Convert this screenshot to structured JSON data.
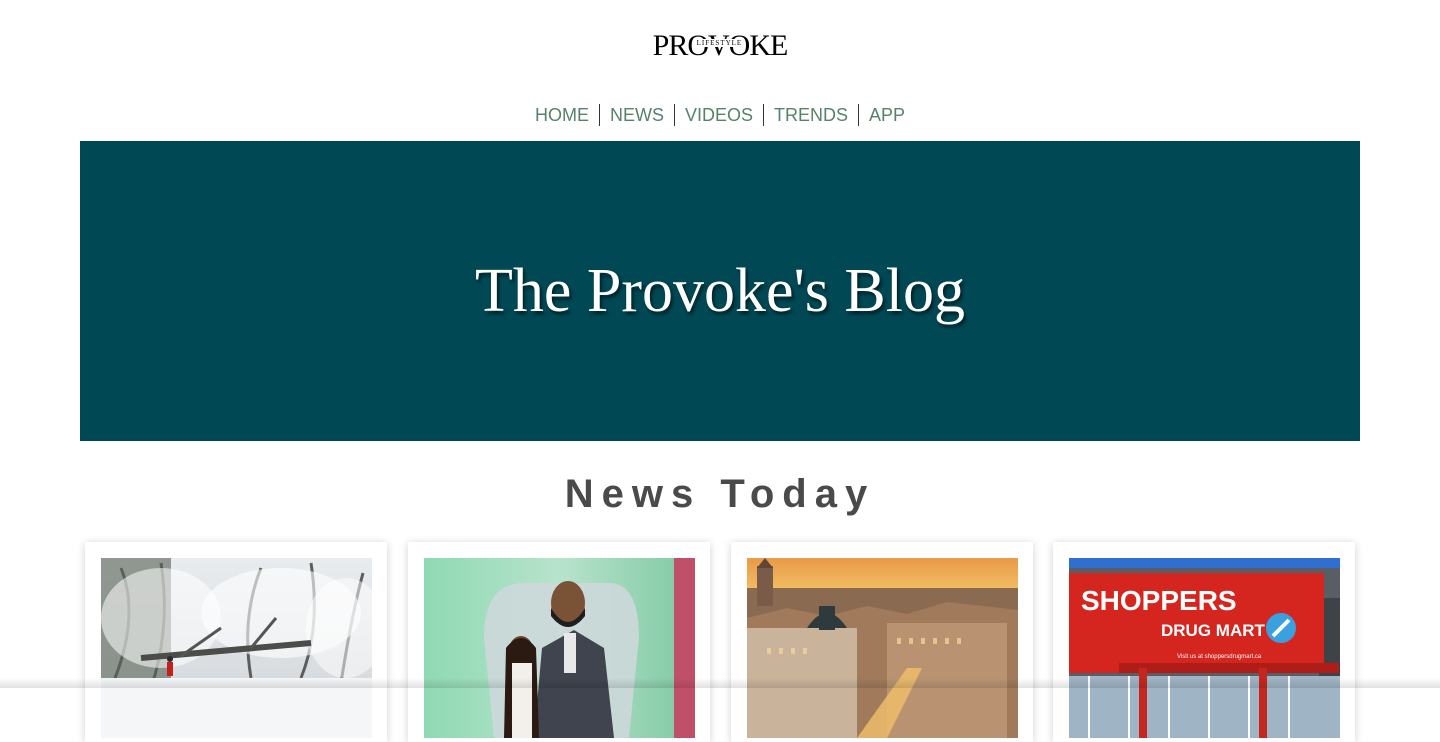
{
  "brand": {
    "logo_main": "PROVOKE",
    "logo_sub": "LIFESTYLE"
  },
  "nav": [
    "HOME",
    "NEWS",
    "VIDEOS",
    "TRENDS",
    "APP"
  ],
  "hero": {
    "title": "The Provoke's Blog"
  },
  "news": {
    "title": "News Today",
    "cards": [
      {
        "image": "snowy-storm-fallen-trees-photo"
      },
      {
        "image": "man-and-girl-portrait-photo"
      },
      {
        "image": "city-skyline-sunset-photo"
      },
      {
        "image": "shoppers-drug-mart-storefront-photo",
        "sign_main": "SHOPPERS",
        "sign_sub": "DRUG MART",
        "sign_small": "Visit us at shoppersdrugmart.ca"
      }
    ]
  },
  "colors": {
    "nav_link": "#55836a",
    "hero_bg": "#004854",
    "section_title": "#4a4a4a"
  }
}
